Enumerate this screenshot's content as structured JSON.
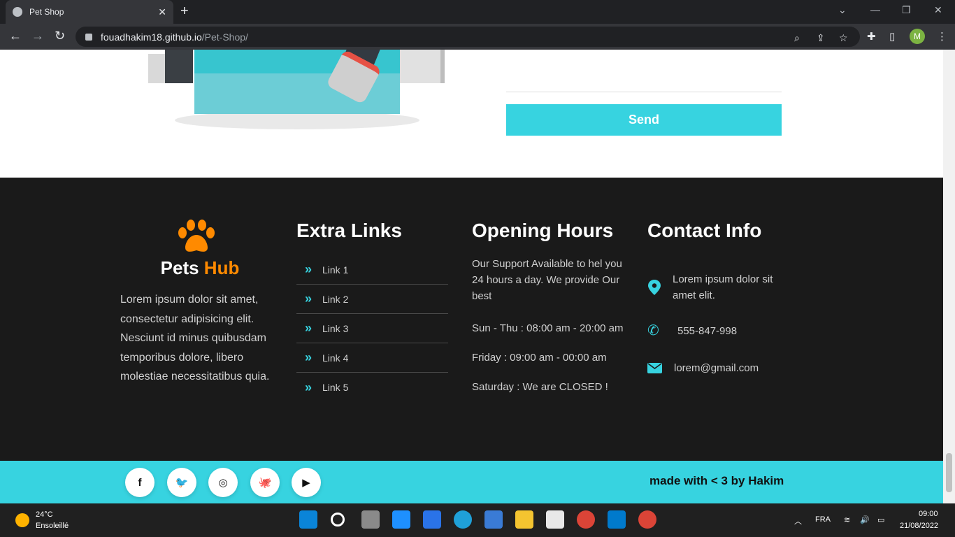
{
  "browser": {
    "tab_title": "Pet Shop",
    "tab_close": "✕",
    "new_tab": "+",
    "url_host": "fouadhakim18.github.io",
    "url_path": "/Pet-Shop/",
    "profile_initial": "M"
  },
  "contact_form": {
    "send_label": "Send"
  },
  "footer": {
    "brand": {
      "name_main": "Pets",
      "name_accent": "Hub",
      "description": "Lorem ipsum dolor sit amet, consectetur adipisicing elit. Nesciunt id minus quibusdam temporibus dolore, libero molestiae necessitatibus quia."
    },
    "links": {
      "heading": "Extra Links",
      "items": [
        {
          "label": "Link 1"
        },
        {
          "label": "Link 2"
        },
        {
          "label": "Link 3"
        },
        {
          "label": "Link 4"
        },
        {
          "label": "Link 5"
        }
      ]
    },
    "hours": {
      "heading": "Opening Hours",
      "intro": "Our Support Available to hel you 24 hours a day. We provide Our best",
      "lines": [
        "Sun - Thu : 08:00 am - 20:00 am",
        "Friday : 09:00 am - 00:00 am",
        "Saturday : We are CLOSED !"
      ]
    },
    "contact": {
      "heading": "Contact Info",
      "address": "Lorem ipsum dolor sit amet elit.",
      "phone": "555-847-998",
      "email": "lorem@gmail.com"
    }
  },
  "bottom_bar": {
    "socials": [
      "facebook",
      "twitter",
      "instagram",
      "github",
      "youtube"
    ],
    "credit": "made with < 3 by Hakim"
  },
  "taskbar": {
    "weather_temp": "24°C",
    "weather_desc": "Ensoleillé",
    "language": "FRA",
    "time": "09:00",
    "date": "21/08/2022"
  },
  "colors": {
    "accent": "#37d3e0",
    "brand_accent": "#ff8a00",
    "footer_bg": "#1a1a1a"
  }
}
